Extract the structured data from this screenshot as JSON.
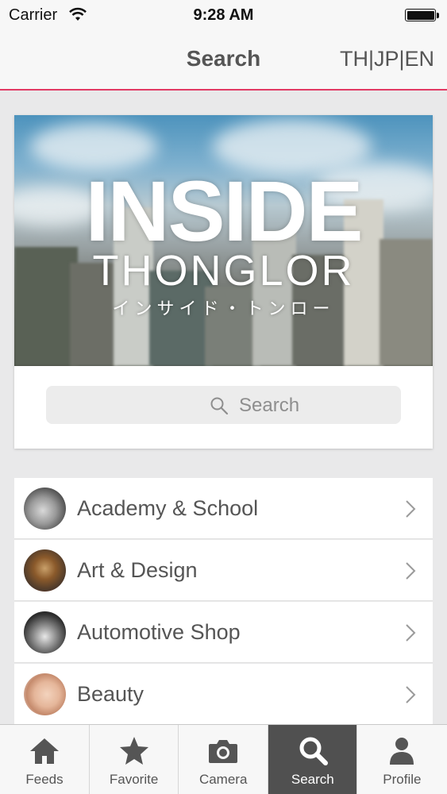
{
  "status_bar": {
    "carrier": "Carrier",
    "time": "9:28 AM"
  },
  "nav": {
    "title": "Search",
    "languages": "TH|JP|EN"
  },
  "hero": {
    "title": "INSIDE",
    "subtitle": "THONGLOR",
    "japanese": "インサイド・トンロー",
    "search_placeholder": "Search"
  },
  "categories": [
    {
      "label": "Academy & School",
      "icon": "academy-thumbnail"
    },
    {
      "label": "Art & Design",
      "icon": "art-thumbnail"
    },
    {
      "label": "Automotive Shop",
      "icon": "car-thumbnail"
    },
    {
      "label": "Beauty",
      "icon": "beauty-thumbnail"
    }
  ],
  "tabs": [
    {
      "label": "Feeds",
      "icon": "home-icon",
      "active": false
    },
    {
      "label": "Favorite",
      "icon": "star-icon",
      "active": false
    },
    {
      "label": "Camera",
      "icon": "camera-icon",
      "active": false
    },
    {
      "label": "Search",
      "icon": "search-icon",
      "active": true
    },
    {
      "label": "Profile",
      "icon": "person-icon",
      "active": false
    }
  ],
  "colors": {
    "accent": "#e23a64",
    "active_tab": "#505050",
    "text": "#555555"
  }
}
